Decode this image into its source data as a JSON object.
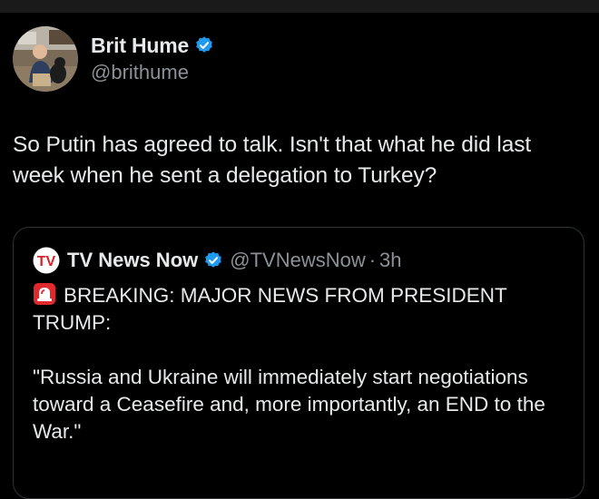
{
  "tweet": {
    "author": {
      "display_name": "Brit Hume",
      "handle": "@brithume",
      "verified": true
    },
    "text": "So Putin has agreed to talk. Isn't that what he did last week when he sent a delegation to Turkey?"
  },
  "quoted_tweet": {
    "avatar_label": "TV",
    "display_name": "TV News Now",
    "handle": "@TVNewsNow",
    "separator": "·",
    "time": "3h",
    "verified": true,
    "headline": "BREAKING: MAJOR NEWS FROM PRESIDENT TRUMP:",
    "quote": "\"Russia and Ukraine will immediately start negotiations toward a Ceasefire and, more importantly, an END to the War.\""
  },
  "colors": {
    "background": "#000000",
    "text_primary": "#e7e9ea",
    "text_secondary": "#8b9197",
    "verified_blue": "#1d9bf0",
    "border": "#2f3336",
    "siren_red": "#e0292d"
  },
  "icons": {
    "verified": "verified-badge-icon",
    "siren": "rotating-light-icon"
  }
}
